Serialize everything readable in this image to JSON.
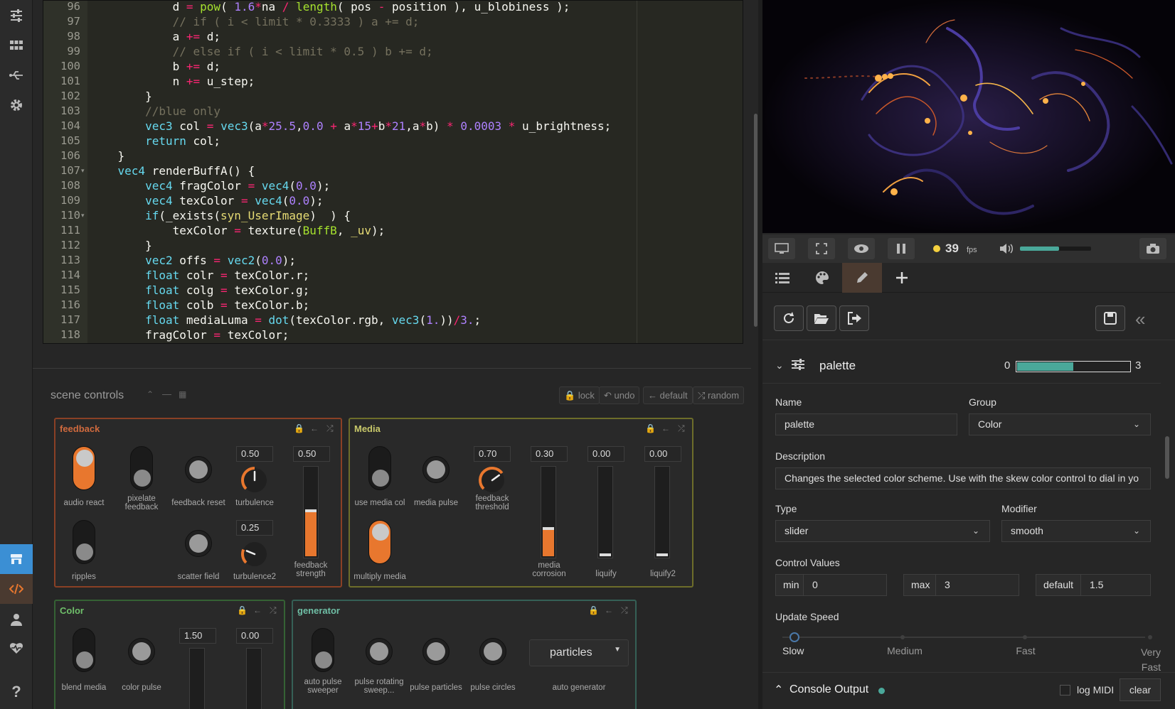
{
  "rail": {
    "icons": [
      "sliders-icon",
      "grid-icon",
      "usb-icon",
      "gear-icon",
      "store-icon",
      "code-icon",
      "user-icon",
      "heart-pulse-icon",
      "help-icon"
    ]
  },
  "editor": {
    "lines": [
      {
        "n": "96",
        "fold": false,
        "html": "            <span class='pl'>d</span> <span class='op'>=</span> <span class='fn'>pow</span><span class='pl'>(</span> <span class='nm'>1.6</span><span class='op'>*</span><span class='pl'>na</span> <span class='op'>/</span> <span class='fn'>length</span><span class='pl'>( pos</span> <span class='op'>-</span> <span class='pl'>position ), u_blobiness );</span>"
      },
      {
        "n": "97",
        "fold": false,
        "html": "            <span class='cm'>// if ( i &lt; limit * 0.3333 ) a += d;</span>"
      },
      {
        "n": "98",
        "fold": false,
        "html": "            <span class='pl'>a</span> <span class='op'>+=</span> <span class='pl'>d;</span>"
      },
      {
        "n": "99",
        "fold": false,
        "html": "            <span class='cm'>// else if ( i &lt; limit * 0.5 ) b += d;</span>"
      },
      {
        "n": "100",
        "fold": false,
        "html": "            <span class='pl'>b</span> <span class='op'>+=</span> <span class='pl'>d;</span>"
      },
      {
        "n": "101",
        "fold": false,
        "html": "            <span class='pl'>n</span> <span class='op'>+=</span> <span class='pl'>u_step;</span>"
      },
      {
        "n": "102",
        "fold": false,
        "html": "        <span class='pl'>}</span>"
      },
      {
        "n": "103",
        "fold": false,
        "html": "        <span class='cm'>//blue only</span>"
      },
      {
        "n": "104",
        "fold": false,
        "html": "        <span class='kw'>vec3</span> <span class='pl'>col</span> <span class='op'>=</span> <span class='kw'>vec3</span><span class='pl'>(a</span><span class='op'>*</span><span class='nm'>25.5</span><span class='pl'>,</span><span class='nm'>0.0</span> <span class='op'>+</span> <span class='pl'>a</span><span class='op'>*</span><span class='nm'>15</span><span class='op'>+</span><span class='pl'>b</span><span class='op'>*</span><span class='nm'>21</span><span class='pl'>,a</span><span class='op'>*</span><span class='pl'>b)</span> <span class='op'>*</span> <span class='nm'>0.0003</span> <span class='op'>*</span> <span class='pl'>u_brightness;</span>"
      },
      {
        "n": "105",
        "fold": false,
        "html": "        <span class='kw'>return</span> <span class='pl'>col;</span>"
      },
      {
        "n": "106",
        "fold": false,
        "html": "    <span class='pl'>}</span>"
      },
      {
        "n": "107",
        "fold": true,
        "html": "    <span class='kw'>vec4</span> <span class='pl'>renderBuffA() {</span>"
      },
      {
        "n": "108",
        "fold": false,
        "html": "        <span class='kw'>vec4</span> <span class='pl'>fragColor</span> <span class='op'>=</span> <span class='kw'>vec4</span><span class='pl'>(</span><span class='nm'>0.0</span><span class='pl'>);</span>"
      },
      {
        "n": "109",
        "fold": false,
        "html": "        <span class='kw'>vec4</span> <span class='pl'>texColor</span> <span class='op'>=</span> <span class='kw'>vec4</span><span class='pl'>(</span><span class='nm'>0.0</span><span class='pl'>);</span>"
      },
      {
        "n": "110",
        "fold": true,
        "html": "        <span class='kw'>if</span><span class='pl'>(_exists(</span><span class='st'>syn_UserImage</span><span class='pl'>)  ) {</span>"
      },
      {
        "n": "111",
        "fold": false,
        "html": "            <span class='pl'>texColor</span> <span class='op'>=</span> <span class='pl'>texture(</span><span class='fn'>BuffB</span><span class='pl'>,</span> <span class='st'>_uv</span><span class='pl'>);</span>"
      },
      {
        "n": "112",
        "fold": false,
        "html": "        <span class='pl'>}</span>"
      },
      {
        "n": "113",
        "fold": false,
        "html": "        <span class='kw'>vec2</span> <span class='pl'>offs</span> <span class='op'>=</span> <span class='kw'>vec2</span><span class='pl'>(</span><span class='nm'>0.0</span><span class='pl'>);</span>"
      },
      {
        "n": "114",
        "fold": false,
        "html": "        <span class='kw'>float</span> <span class='pl'>colr</span> <span class='op'>=</span> <span class='pl'>texColor.r;</span>"
      },
      {
        "n": "115",
        "fold": false,
        "html": "        <span class='kw'>float</span> <span class='pl'>colg</span> <span class='op'>=</span> <span class='pl'>texColor.g;</span>"
      },
      {
        "n": "116",
        "fold": false,
        "html": "        <span class='kw'>float</span> <span class='pl'>colb</span> <span class='op'>=</span> <span class='pl'>texColor.b;</span>"
      },
      {
        "n": "117",
        "fold": false,
        "html": "        <span class='kw'>float</span> <span class='pl'>mediaLuma</span> <span class='op'>=</span> <span class='kw'>dot</span><span class='pl'>(texColor.rgb,</span> <span class='kw'>vec3</span><span class='pl'>(</span><span class='nm'>1.</span><span class='pl'>))</span><span class='op'>/</span><span class='nm'>3.</span><span class='pl'>;</span>"
      },
      {
        "n": "118",
        "fold": false,
        "html": "        <span class='pl'>fragColor</span> <span class='op'>=</span> <span class='pl'>texColor;</span>"
      }
    ]
  },
  "scene": {
    "title": "scene controls",
    "toolbar": {
      "lock": "lock",
      "undo": "undo",
      "default": "default",
      "random": "random"
    },
    "feedback": {
      "title": "feedback",
      "color": "#b4532a",
      "audio_react": "audio react",
      "pixelate": "pixelate feedback",
      "feedback_reset": "feedback reset",
      "turbulence": "turbulence",
      "turbulence_val": "0.50",
      "turbulence_level": 0.5,
      "strength": "feedback strength",
      "strength_val": "0.50",
      "strength_level": 0.5,
      "ripples": "ripples",
      "scatter": "scatter field",
      "turbulence2": "turbulence2",
      "turbulence2_val": "0.25",
      "turbulence2_level": 0.25
    },
    "media": {
      "title": "Media",
      "color": "#7a7a2e",
      "use_media_col": "use media col",
      "media_pulse": "media pulse",
      "multiply": "multiply media",
      "threshold": "feedback threshold",
      "threshold_val": "0.70",
      "threshold_level": 0.7,
      "corrosion": "media corrosion",
      "corrosion_val": "0.30",
      "corrosion_level": 0.3,
      "liquify": "liquify",
      "liquify_val": "0.00",
      "liquify_level": 0,
      "liquify2": "liquify2",
      "liquify2_val": "0.00",
      "liquify2_level": 0
    },
    "color": {
      "title": "Color",
      "color": "#3e6b3a",
      "blend": "blend media",
      "pulse": "color pulse",
      "s1_val": "1.50",
      "s2_val": "0.00"
    },
    "generator": {
      "title": "generator",
      "color": "#3c6a5a",
      "sweeper": "auto pulse sweeper",
      "rotating": "pulse rotating sweep...",
      "particles": "pulse particles",
      "circles": "pulse circles",
      "auto_gen": "auto generator",
      "auto_gen_value": "particles"
    }
  },
  "transport": {
    "fps": "39",
    "fps_unit": "fps",
    "volume_level": 0.55
  },
  "editpane": {
    "header": {
      "name": "palette",
      "min": "0",
      "max": "3",
      "value_level": 0.5
    },
    "name_label": "Name",
    "name_value": "palette",
    "group_label": "Group",
    "group_value": "Color",
    "desc_label": "Description",
    "desc_value": "Changes the selected color scheme. Use with the skew color control to dial in yo",
    "type_label": "Type",
    "type_value": "slider",
    "modifier_label": "Modifier",
    "modifier_value": "smooth",
    "cv_label": "Control Values",
    "min_label": "min",
    "min_value": "0",
    "max_label": "max",
    "max_value": "3",
    "default_label": "default",
    "default_value": "1.5",
    "speed_label": "Update Speed",
    "speed_ticks": [
      "Slow",
      "Medium",
      "Fast",
      "Very Fast"
    ],
    "console": "Console Output",
    "log_midi": "log MIDI",
    "clear": "clear"
  },
  "colors": {
    "accent": "#e8772e",
    "active_rail": "#3b8fd4",
    "active_tab": "#4a3a30"
  }
}
